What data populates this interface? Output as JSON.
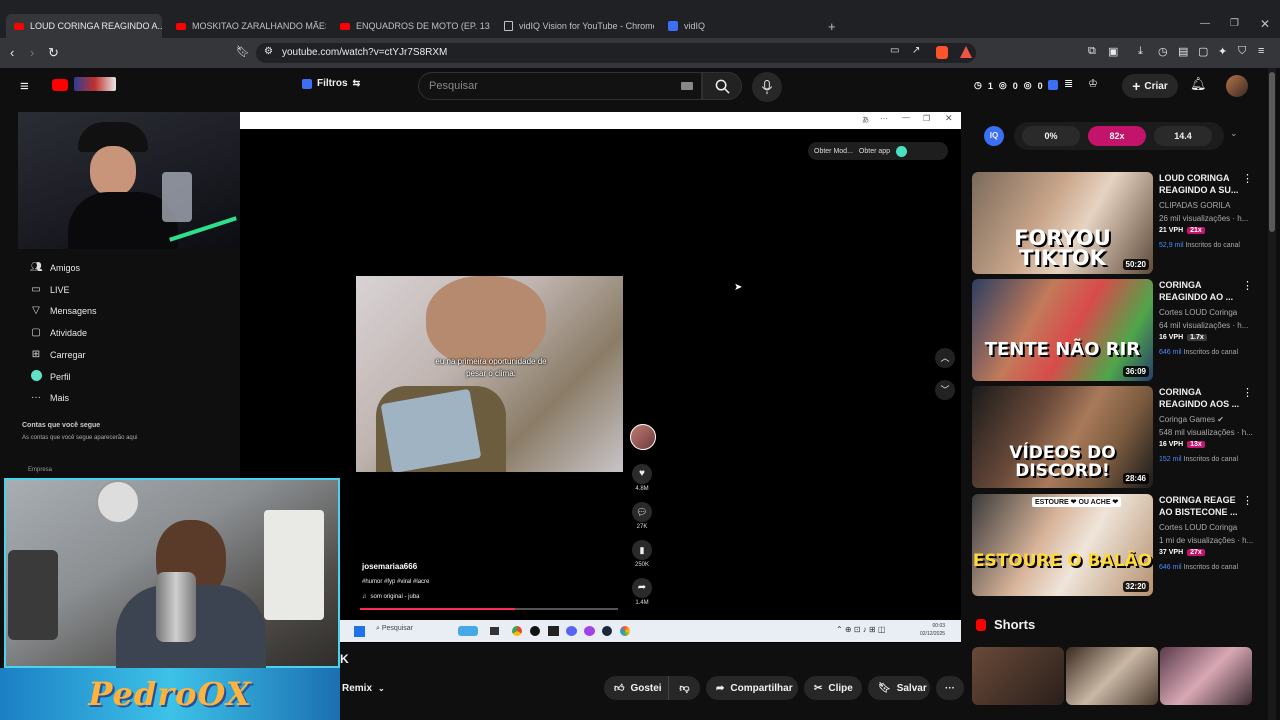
{
  "browser": {
    "tabs": [
      {
        "label": "LOUD CORINGA REAGINDO A...",
        "icon": "youtube-favicon",
        "active": true
      },
      {
        "label": "MOSKITAO ZARALHANDO MÃES SO...",
        "icon": "youtube-favicon",
        "active": false
      },
      {
        "label": "ENQUADROS DE MOTO (EP. 131) - Y...",
        "icon": "youtube-favicon",
        "active": false
      },
      {
        "label": "vidIQ Vision for YouTube - Chrome W...",
        "icon": "page-favicon",
        "active": false
      },
      {
        "label": "vidIQ",
        "icon": "vidiq-favicon",
        "active": false
      }
    ],
    "url": "youtube.com/watch?v=ctYJr7S8RXM"
  },
  "yt_header": {
    "filters_label": "Filtros",
    "search_placeholder": "Pesquisar",
    "counters": [
      "1",
      "0",
      "0"
    ],
    "create_label": "Criar"
  },
  "sidebar": {
    "items": [
      {
        "label": "Amigos",
        "icon": "people-icon"
      },
      {
        "label": "LIVE",
        "icon": "live-icon"
      },
      {
        "label": "Mensagens",
        "icon": "send-icon"
      },
      {
        "label": "Atividade",
        "icon": "activity-icon"
      },
      {
        "label": "Carregar",
        "icon": "upload-icon"
      },
      {
        "label": "Perfil",
        "icon": "profile-icon"
      },
      {
        "label": "Mais",
        "icon": "more-icon"
      }
    ],
    "following_title": "Contas que você segue",
    "following_hint": "As contas que você segue aparecerão aqui",
    "company_label": "Empresa"
  },
  "tiktok": {
    "get_mode": "Obter Mod...",
    "get_app": "Obter app",
    "caption": "eu na primeira oportunidade de pesar o clima:",
    "username": "josemariaa666",
    "hashtags": "#humor #fyp #viral #lacre",
    "sound": "som original - juba",
    "likes": "4.8M",
    "comments": "27K",
    "saves": "250K",
    "shares": "1.4M",
    "taskbar_search": "Pesquisar",
    "taskbar_time": "00:03",
    "taskbar_date": "02/12/2025"
  },
  "banner_text": "PedroOX",
  "vidiq": {
    "percent": "0%",
    "multiplier": "82x",
    "score": "14.4"
  },
  "recommended": [
    {
      "title": "LOUD CORINGA REAGINDO A SU...",
      "channel": "CLIPADAS GORILA",
      "meta": "26 mil visualizações · h...",
      "vph": "21 VPH",
      "mult": "21x",
      "subs": "52,9 mil",
      "subs_label": "Inscritos do canal",
      "duration": "50:20",
      "thumb_text": "FORYOU TIKTOK"
    },
    {
      "title": "CORINGA REAGINDO AO ...",
      "channel": "Cortes LOUD Coringa",
      "meta": "64 mil visualizações · h...",
      "vph": "16 VPH",
      "mult": "1.7x",
      "subs": "646 mil",
      "subs_label": "Inscritos do canal",
      "duration": "36:09",
      "thumb_text": "TENTE NÃO RIR"
    },
    {
      "title": "CORINGA REAGINDO AOS ...",
      "channel": "Coringa Games",
      "meta": "548 mil visualizações · h...",
      "vph": "16 VPH",
      "mult": "13x",
      "subs": "152 mil",
      "subs_label": "Inscritos do canal",
      "duration": "28:46",
      "thumb_text": "VÍDEOS DO DISCORD!"
    },
    {
      "title": "CORINGA REAGE AO BISTECONE ...",
      "channel": "Cortes LOUD Coringa",
      "meta": "1 mi de visualizações · h...",
      "vph": "37 VPH",
      "mult": "27x",
      "subs": "646 mil",
      "subs_label": "Inscritos do canal",
      "duration": "32:20",
      "thumb_text": "ESTOURE O BALÃO",
      "badge": "ESTOURE ❤ OU ACHE ❤"
    }
  ],
  "shorts_label": "Shorts",
  "actions": {
    "remix": "Remix",
    "like": "Gostei",
    "share": "Compartilhar",
    "clip": "Clipe",
    "save": "Salvar"
  },
  "colors": {
    "accent": "#ff0000",
    "vidiq_pink": "#c4136a",
    "webcam_border": "#4ad3ee"
  }
}
